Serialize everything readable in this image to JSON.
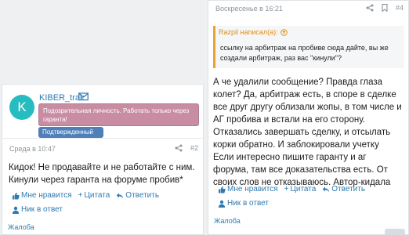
{
  "left_post": {
    "avatar_letter": "K",
    "avatar_color": "#26bcc0",
    "username": "KIBER_trak",
    "user_title": "Подозрительная личность. Работать только через гаранта!",
    "verified_label": "Подтвержденный",
    "date": "Среда в 10:47",
    "post_number": "#2",
    "message": "Кидок! Не продавайте и не работайте с ним. Кинули через гаранта на форуме пробив*",
    "actions": {
      "like": "Мне нравится",
      "quote": "Цитата",
      "reply": "Ответить",
      "mention": "Ник в ответ"
    },
    "report": "Жалоба"
  },
  "right_post": {
    "date": "Воскресенье в 16:21",
    "post_number": "#4",
    "quote_author": "Razpil написал(а):",
    "quote_text": "ссылку на арбитраж на пробиве сюда дайте, вы же создали арбитраж, раз вас \"кинули\"?",
    "message": "А че удалили сообщение? Правда глаза колет? Да, арбитраж есть, в споре в сделке все друг другу облизали жопы, в том числе и АГ пробива и встали на его сторону. Отказались завершать сделку, и отсылать корки обратно. И заблокировали учетку\nЕсли интересно пишите гаранту и аг форума, там все доказательства есть. От своих слов не отказываюсь. Автор-кидала",
    "actions": {
      "like": "Мне нравится",
      "quote": "Цитата",
      "reply": "Ответить",
      "mention": "Ник в ответ"
    },
    "report": "Жалоба"
  },
  "colors": {
    "link": "#2f7bb1",
    "quote_accent": "#e6a235",
    "suspicious_badge": "#c98da3",
    "verified_badge": "#4e7fb8"
  }
}
